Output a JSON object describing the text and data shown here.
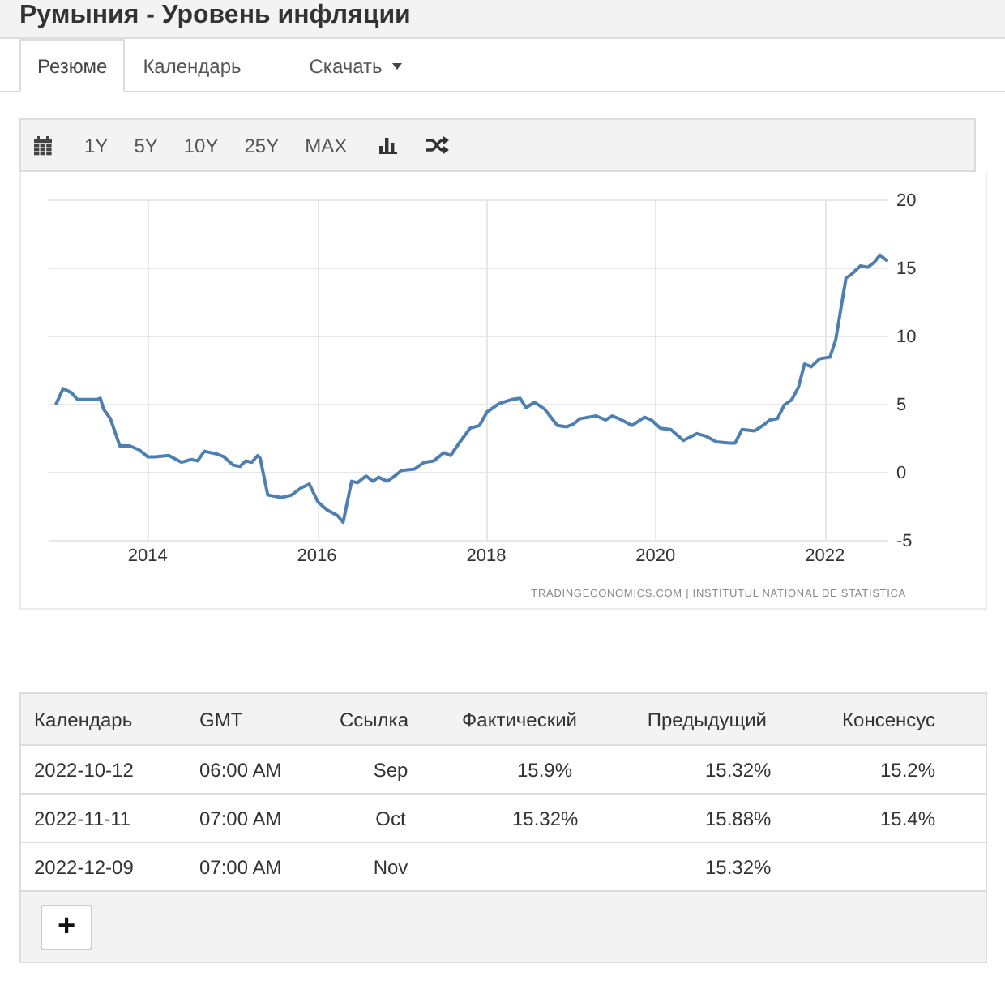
{
  "title": "Румыния - Уровень инфляции",
  "tabs": [
    {
      "label": "Резюме",
      "kind": "tab",
      "selected": true
    },
    {
      "label": "Календарь",
      "kind": "tab",
      "selected": false
    },
    {
      "label": "Скачать",
      "kind": "dropdown",
      "selected": false
    }
  ],
  "chart_toolbar": {
    "ranges": [
      {
        "label": "1Y",
        "selected": false
      },
      {
        "label": "5Y",
        "selected": false
      },
      {
        "label": "10Y",
        "selected": false
      },
      {
        "label": "25Y",
        "selected": false
      },
      {
        "label": "MAX",
        "selected": false
      }
    ]
  },
  "chart": {
    "source": "TRADINGECONOMICS.COM | INSTITUTUL NATIONAL DE STATISTICA",
    "chart_data": {
      "type": "line",
      "grid": true,
      "x": [
        2012.92,
        2013.0,
        2013.1,
        2013.17,
        2013.4,
        2013.44,
        2013.48,
        2013.56,
        2013.67,
        2013.79,
        2013.9,
        2014.0,
        2014.09,
        2014.25,
        2014.4,
        2014.51,
        2014.59,
        2014.67,
        2014.82,
        2014.9,
        2015.01,
        2015.09,
        2015.16,
        2015.23,
        2015.3,
        2015.33,
        2015.42,
        2015.51,
        2015.58,
        2015.7,
        2015.81,
        2015.91,
        2016.01,
        2016.12,
        2016.24,
        2016.31,
        2016.41,
        2016.48,
        2016.58,
        2016.66,
        2016.73,
        2016.83,
        2016.92,
        2017.0,
        2017.15,
        2017.27,
        2017.38,
        2017.5,
        2017.58,
        2017.69,
        2017.81,
        2017.92,
        2018.01,
        2018.15,
        2018.3,
        2018.4,
        2018.47,
        2018.57,
        2018.69,
        2018.84,
        2018.95,
        2019.03,
        2019.11,
        2019.3,
        2019.41,
        2019.49,
        2019.6,
        2019.72,
        2019.87,
        2019.95,
        2020.06,
        2020.18,
        2020.33,
        2020.49,
        2020.6,
        2020.72,
        2020.87,
        2020.94,
        2021.02,
        2021.17,
        2021.27,
        2021.35,
        2021.44,
        2021.52,
        2021.61,
        2021.69,
        2021.76,
        2021.84,
        2021.94,
        2022.06,
        2022.13,
        2022.19,
        2022.25,
        2022.32,
        2022.42,
        2022.51,
        2022.59,
        2022.65,
        2022.73
      ],
      "values": [
        5.0,
        6.1,
        5.8,
        5.3,
        5.3,
        5.4,
        4.6,
        3.9,
        1.9,
        1.9,
        1.6,
        1.1,
        1.1,
        1.2,
        0.7,
        0.9,
        0.8,
        1.5,
        1.3,
        1.1,
        0.5,
        0.4,
        0.8,
        0.7,
        1.2,
        1.0,
        -1.7,
        -1.8,
        -1.9,
        -1.7,
        -1.2,
        -0.9,
        -2.2,
        -2.8,
        -3.2,
        -3.7,
        -0.7,
        -0.8,
        -0.3,
        -0.7,
        -0.4,
        -0.7,
        -0.3,
        0.1,
        0.2,
        0.7,
        0.8,
        1.4,
        1.2,
        2.2,
        3.2,
        3.4,
        4.4,
        5.0,
        5.3,
        5.4,
        4.7,
        5.1,
        4.6,
        3.4,
        3.3,
        3.5,
        3.9,
        4.1,
        3.8,
        4.1,
        3.8,
        3.4,
        4.0,
        3.8,
        3.2,
        3.1,
        2.3,
        2.8,
        2.6,
        2.2,
        2.1,
        2.1,
        3.1,
        3.0,
        3.4,
        3.8,
        3.9,
        4.9,
        5.3,
        6.2,
        7.9,
        7.7,
        8.3,
        8.4,
        9.7,
        12.0,
        14.2,
        14.5,
        15.1,
        15.0,
        15.4,
        15.9,
        15.5
      ],
      "xlim": [
        2012.83,
        2022.75
      ],
      "ylim": [
        -5,
        20
      ],
      "xticks": [
        2014,
        2016,
        2018,
        2020,
        2022
      ],
      "yticks": [
        -5,
        0,
        5,
        10,
        15,
        20
      ]
    }
  },
  "calendar_table": {
    "columns": [
      "Календарь",
      "GMT",
      "Ссылка",
      "Фактический",
      "Предыдущий",
      "Консенсус"
    ],
    "rows": [
      {
        "date": "2022-10-12",
        "time": "06:00 AM",
        "reference": "Sep",
        "actual": "15.9%",
        "previous": "15.32%",
        "consensus": "15.2%"
      },
      {
        "date": "2022-11-11",
        "time": "07:00 AM",
        "reference": "Oct",
        "actual": "15.32%",
        "previous": "15.88%",
        "consensus": "15.4%"
      },
      {
        "date": "2022-12-09",
        "time": "07:00 AM",
        "reference": "Nov",
        "previous": "15.32%"
      }
    ],
    "add_button": "+"
  }
}
